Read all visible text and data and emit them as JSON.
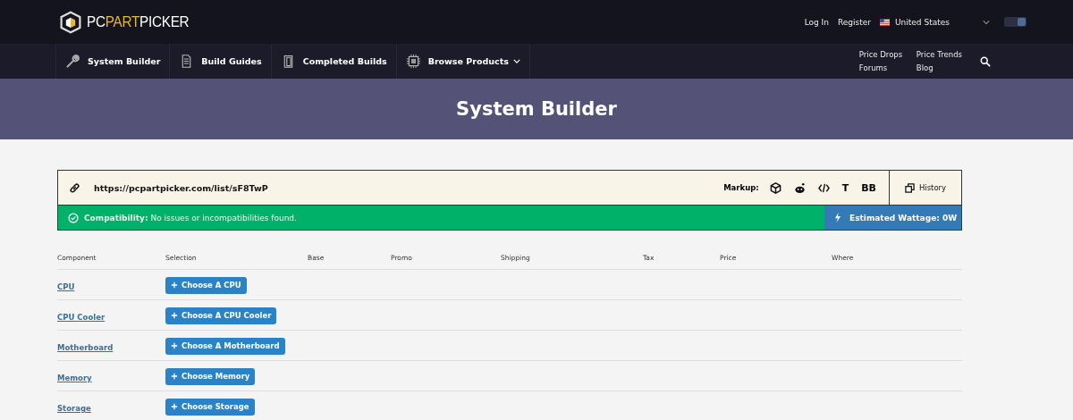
{
  "logo": [
    {
      "text": "PC",
      "highlight": false
    },
    {
      "text": "PART",
      "highlight": true
    },
    {
      "text": "PICKER",
      "highlight": false
    }
  ],
  "account": {
    "login": "Log In",
    "register": "Register",
    "country": "United States"
  },
  "theme_toggle": {
    "on": true
  },
  "nav": [
    {
      "label": "System Builder",
      "kind": "wrench",
      "dropdown": false
    },
    {
      "label": "Build Guides",
      "kind": "doc",
      "dropdown": false
    },
    {
      "label": "Completed Builds",
      "kind": "case",
      "dropdown": false
    },
    {
      "label": "Browse Products",
      "kind": "chip",
      "dropdown": true
    }
  ],
  "nav_links": [
    "Price Drops",
    "Price Trends",
    "Forums",
    "Blog"
  ],
  "page_title": "System Builder",
  "list_url": "https://pcpartpicker.com/list/sF8TwP",
  "markup_label": "Markup:",
  "markup_buttons": [
    {
      "kind": "cube"
    },
    {
      "kind": "reddit"
    },
    {
      "kind": "code"
    },
    {
      "kind": "text",
      "label": "T"
    },
    {
      "kind": "text",
      "label": "BB"
    }
  ],
  "history_button": "History",
  "compatibility": "**Compatibility:** No issues or incompatibilities found.",
  "wattage": "Estimated Wattage: 0W",
  "table": {
    "columns": [
      "Component",
      "Selection",
      "Base",
      "Promo",
      "Shipping",
      "Tax",
      "Price",
      "Where"
    ],
    "rows": [
      {
        "component": "CPU",
        "button": "Choose A CPU"
      },
      {
        "component": "CPU Cooler",
        "button": "Choose A CPU Cooler"
      },
      {
        "component": "Motherboard",
        "button": "Choose A Motherboard"
      },
      {
        "component": "Memory",
        "button": "Choose Memory"
      },
      {
        "component": "Storage",
        "button": "Choose Storage"
      }
    ]
  }
}
